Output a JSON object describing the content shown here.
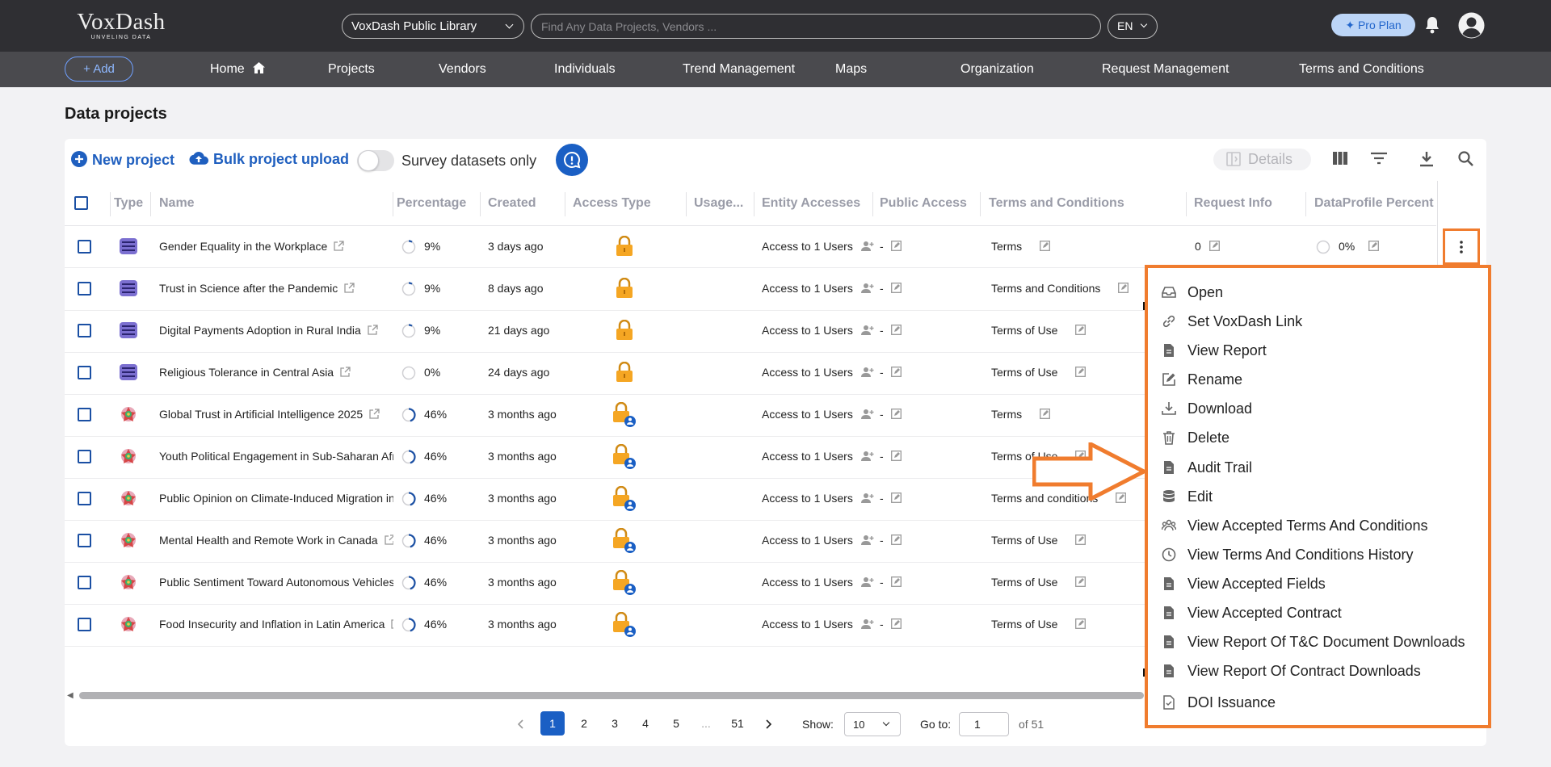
{
  "logo": {
    "main": "VoxDash",
    "sub": "UNVELING DATA"
  },
  "header": {
    "library": "VoxDash Public Library",
    "search_placeholder": "Find Any Data Projects, Vendors ...",
    "language": "EN",
    "pro_plan": "✦ Pro Plan"
  },
  "nav": {
    "add": "+ Add",
    "items": [
      "Home",
      "Projects",
      "Vendors",
      "Individuals",
      "Trend Management",
      "Maps",
      "Organization",
      "Request Management",
      "Terms and Conditions"
    ]
  },
  "page_title": "Data projects",
  "toolbar": {
    "new_project": "New project",
    "bulk_upload": "Bulk project upload",
    "survey_toggle": "Survey datasets only",
    "survey_toggle_on": false,
    "details": "Details"
  },
  "columns": [
    "Type",
    "Name",
    "Percentage",
    "Created",
    "Access Type",
    "Usage...",
    "Entity Accesses",
    "Public Access",
    "Terms and Conditions",
    "Request Info",
    "DataProfile Percent"
  ],
  "rows": [
    {
      "type": "dataset",
      "name": "Gender Equality in the Workplace",
      "percentage": "9%",
      "pct": 0.09,
      "created": "3 days ago",
      "access": "locked",
      "entity": "Access to 1 Users",
      "public": "-",
      "terms": "Terms",
      "request": "0",
      "profile": "0%"
    },
    {
      "type": "dataset",
      "name": "Trust in Science after the Pandemic",
      "percentage": "9%",
      "pct": 0.09,
      "created": "8 days ago",
      "access": "locked",
      "entity": "Access to 1 Users",
      "public": "-",
      "terms": "Terms and Conditions"
    },
    {
      "type": "dataset",
      "name": "Digital Payments Adoption in Rural India",
      "percentage": "9%",
      "pct": 0.09,
      "created": "21 days ago",
      "access": "locked",
      "entity": "Access to 1 Users",
      "public": "-",
      "terms": "Terms of Use"
    },
    {
      "type": "dataset",
      "name": "Religious Tolerance in Central Asia",
      "percentage": "0%",
      "pct": 0,
      "created": "24 days ago",
      "access": "locked",
      "entity": "Access to 1 Users",
      "public": "-",
      "terms": "Terms of Use"
    },
    {
      "type": "survey",
      "name": "Global Trust in Artificial Intelligence 2025",
      "percentage": "46%",
      "pct": 0.46,
      "created": "3 months ago",
      "access": "locked-user",
      "entity": "Access to 1 Users",
      "public": "-",
      "terms": "Terms"
    },
    {
      "type": "survey",
      "name": "Youth Political Engagement in Sub-Saharan Africa",
      "percentage": "46%",
      "pct": 0.46,
      "created": "3 months ago",
      "access": "locked-user",
      "entity": "Access to 1 Users",
      "public": "-",
      "terms": "Terms of Use"
    },
    {
      "type": "survey",
      "name": "Public Opinion on Climate-Induced Migration in",
      "percentage": "46%",
      "pct": 0.46,
      "created": "3 months ago",
      "access": "locked-user",
      "entity": "Access to 1 Users",
      "public": "-",
      "terms": "Terms and conditions"
    },
    {
      "type": "survey",
      "name": "Mental Health and Remote Work in Canada",
      "percentage": "46%",
      "pct": 0.46,
      "created": "3 months ago",
      "access": "locked-user",
      "entity": "Access to 1 Users",
      "public": "-",
      "terms": "Terms of Use"
    },
    {
      "type": "survey",
      "name": "Public Sentiment Toward Autonomous Vehicles",
      "percentage": "46%",
      "pct": 0.46,
      "created": "3 months ago",
      "access": "locked-user",
      "entity": "Access to 1 Users",
      "public": "-",
      "terms": "Terms of Use"
    },
    {
      "type": "survey",
      "name": "Food Insecurity and Inflation in Latin America",
      "percentage": "46%",
      "pct": 0.46,
      "created": "3 months ago",
      "access": "locked-user",
      "entity": "Access to 1 Users",
      "public": "-",
      "terms": "Terms of Use"
    }
  ],
  "menu": [
    {
      "label": "Open",
      "icon": "inbox-icon"
    },
    {
      "label": "Set VoxDash Link",
      "icon": "link-icon"
    },
    {
      "label": "View Report",
      "icon": "document-icon"
    },
    {
      "label": "Rename",
      "icon": "pencil-icon"
    },
    {
      "label": "Download",
      "icon": "download-icon"
    },
    {
      "label": "Delete",
      "icon": "trash-icon"
    },
    {
      "label": "Audit Trail",
      "icon": "document-icon"
    },
    {
      "label": "Edit",
      "icon": "database-icon"
    },
    {
      "label": "View Accepted Terms And Conditions",
      "icon": "group-icon"
    },
    {
      "label": "View Terms And Conditions History",
      "icon": "clock-icon"
    },
    {
      "label": "View Accepted Fields",
      "icon": "document-icon"
    },
    {
      "label": "View Accepted Contract",
      "icon": "document-icon"
    },
    {
      "label": "View Report Of T&C Document Downloads",
      "icon": "document-icon"
    },
    {
      "label": "View Report Of Contract Downloads",
      "icon": "document-icon"
    },
    {
      "label": "DOI Issuance",
      "icon": "doc-check-icon"
    }
  ],
  "pagination": {
    "pages": [
      "1",
      "2",
      "3",
      "4",
      "5",
      "...",
      "51"
    ],
    "current": "1",
    "show_label": "Show:",
    "show_value": "10",
    "goto_label": "Go to:",
    "goto_value": "1",
    "of_label": "of 51"
  },
  "colors": {
    "accent": "#1a5fc4",
    "highlight": "#f07c2e",
    "lock": "#f5a623"
  }
}
